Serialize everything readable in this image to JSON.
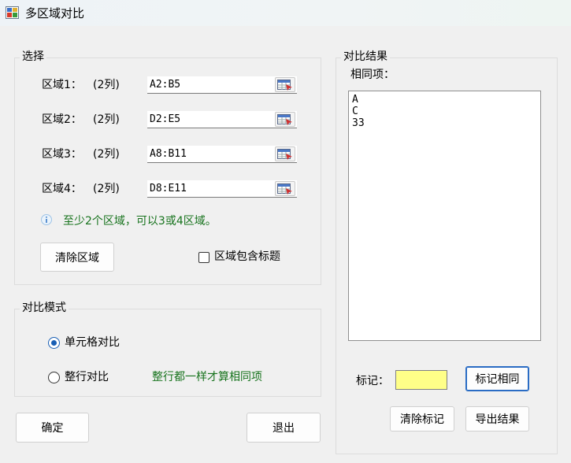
{
  "window": {
    "title": "多区域对比"
  },
  "select_group": {
    "legend": "选择",
    "rows": [
      {
        "label": "区域1：",
        "cols": "(2列)",
        "range": "A2:B5"
      },
      {
        "label": "区域2：",
        "cols": "(2列)",
        "range": "D2:E5"
      },
      {
        "label": "区域3：",
        "cols": "(2列)",
        "range": "A8:B11"
      },
      {
        "label": "区域4：",
        "cols": "(2列)",
        "range": "D8:E11"
      }
    ],
    "hint": "至少2个区域，可以3或4区域。",
    "clear_button": "清除区域",
    "header_checkbox": {
      "label": "区域包含标题",
      "checked": false
    }
  },
  "mode_group": {
    "legend": "对比模式",
    "cell_mode": {
      "label": "单元格对比",
      "checked": true
    },
    "row_mode": {
      "label": "整行对比",
      "checked": false
    },
    "row_mode_hint": "整行都一样才算相同项"
  },
  "buttons": {
    "ok": "确定",
    "exit": "退出"
  },
  "result_group": {
    "legend": "对比结果",
    "same_label": "相同项：",
    "items": [
      "A",
      "C",
      "33"
    ],
    "mark_label": "标记：",
    "mark_color": "#ffff88",
    "mark_same_button": "标记相同",
    "clear_mark_button": "清除标记",
    "export_button": "导出结果"
  },
  "icons": {
    "app": "app-grid-icon",
    "picker": "range-picker-icon",
    "info": "info-icon"
  }
}
